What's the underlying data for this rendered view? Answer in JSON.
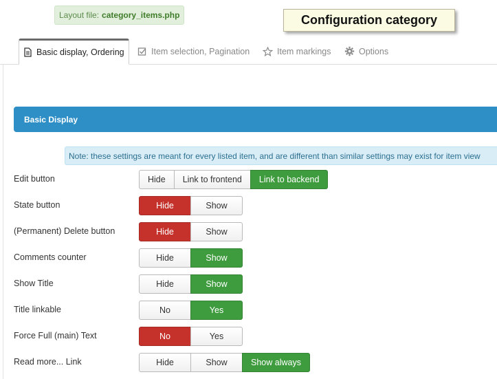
{
  "layout_file": {
    "label": "Layout file:",
    "value": "category_items.php"
  },
  "config_title": "Configuration category",
  "tabs": [
    {
      "label": "Basic display, Ordering",
      "icon": "document-icon",
      "active": true
    },
    {
      "label": "Item selection, Pagination",
      "icon": "checkbox-icon",
      "active": false
    },
    {
      "label": "Item markings",
      "icon": "star-icon",
      "active": false
    },
    {
      "label": "Options",
      "icon": "gear-icon",
      "active": false
    }
  ],
  "section_title": "Basic Display",
  "note": "Note: these settings are meant for every listed item, and are different than similar settings may exist for item view",
  "colors": {
    "accent_blue": "#2d8fc6",
    "active_red": "#c5322c",
    "active_green": "#3e9c3e"
  },
  "settings": [
    {
      "label": "Edit button",
      "options": [
        "Hide",
        "Link to frontend",
        "Link to backend"
      ],
      "selected": 2,
      "selected_color": "green"
    },
    {
      "label": "State button",
      "options": [
        "Hide",
        "Show"
      ],
      "selected": 0,
      "selected_color": "red"
    },
    {
      "label": "(Permanent) Delete button",
      "options": [
        "Hide",
        "Show"
      ],
      "selected": 0,
      "selected_color": "red"
    },
    {
      "label": "Comments counter",
      "options": [
        "Hide",
        "Show"
      ],
      "selected": 1,
      "selected_color": "green"
    },
    {
      "label": "Show Title",
      "options": [
        "Hide",
        "Show"
      ],
      "selected": 1,
      "selected_color": "green"
    },
    {
      "label": "Title linkable",
      "options": [
        "No",
        "Yes"
      ],
      "selected": 1,
      "selected_color": "green"
    },
    {
      "label": "Force Full (main) Text",
      "options": [
        "No",
        "Yes"
      ],
      "selected": 0,
      "selected_color": "red"
    },
    {
      "label": "Read more... Link",
      "options": [
        "Hide",
        "Show",
        "Show always"
      ],
      "selected": 2,
      "selected_color": "green"
    }
  ]
}
